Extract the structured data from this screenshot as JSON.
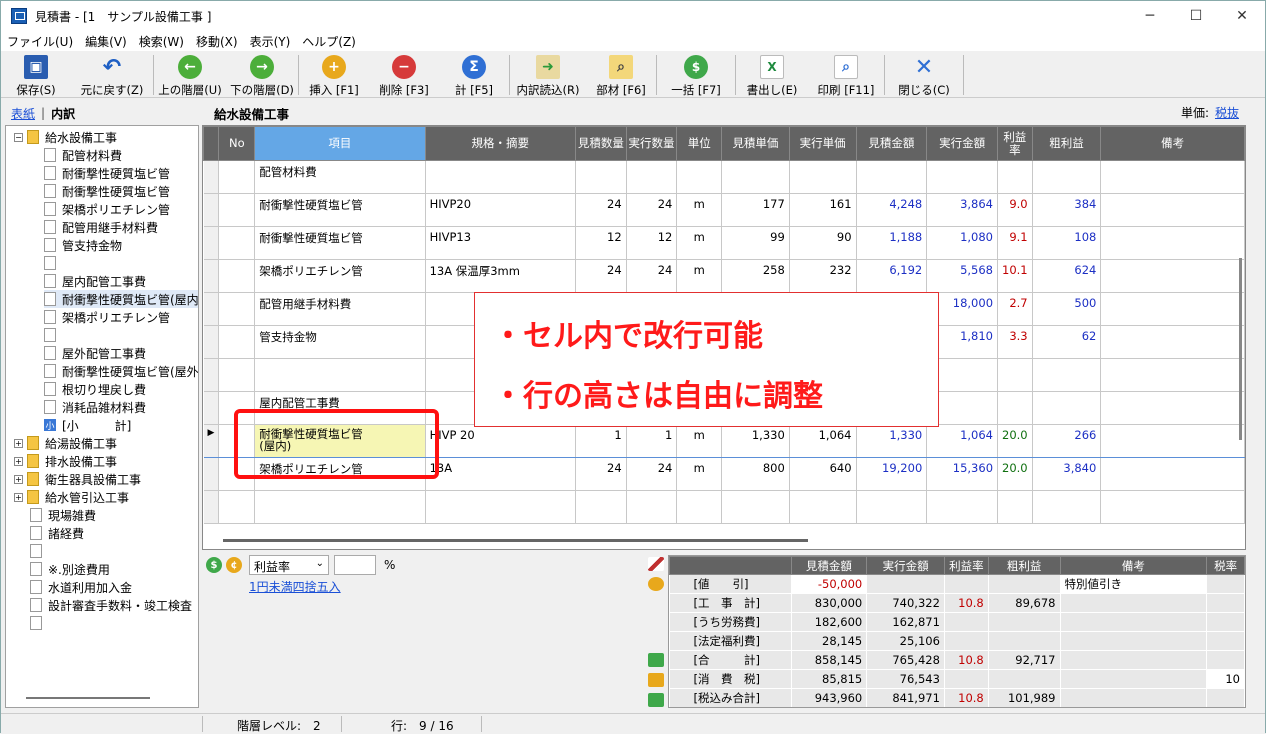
{
  "window": {
    "title": "見積書 - [1　サンプル設備工事 ]",
    "controls": [
      "─",
      "☐",
      "✕"
    ]
  },
  "menu": [
    {
      "label": "ファイル(U)",
      "name": "menu-file"
    },
    {
      "label": "編集(V)",
      "name": "menu-edit"
    },
    {
      "label": "検索(W)",
      "name": "menu-search"
    },
    {
      "label": "移動(X)",
      "name": "menu-move"
    },
    {
      "label": "表示(Y)",
      "name": "menu-view"
    },
    {
      "label": "ヘルプ(Z)",
      "name": "menu-help"
    }
  ],
  "toolbar": {
    "save": "保存(S)",
    "undo": "元に戻す(Z)",
    "up": "上の階層(U)",
    "down": "下の階層(D)",
    "insert": "挿入 [F1]",
    "delete": "削除 [F3]",
    "total": "計 [F5]",
    "import": "内訳読込(R)",
    "materials": "部材 [F6]",
    "bulk": "一括 [F7]",
    "export": "書出し(E)",
    "print": "印刷 [F11]",
    "close": "閉じる(C)"
  },
  "left_tabs": {
    "cover": "表紙",
    "detail": "内訳"
  },
  "tree": [
    "給水設備工事",
    "配管材料費",
    "耐衝撃性硬質塩ビ管",
    "耐衝撃性硬質塩ビ管",
    "架橋ポリエチレン管",
    "配管用継手材料費",
    "管支持金物",
    "",
    "屋内配管工事費",
    "耐衝撃性硬質塩ビ管(屋内",
    "架橋ポリエチレン管",
    "",
    "屋外配管工事費",
    "耐衝撃性硬質塩ビ管(屋外",
    "根切り埋戻し費",
    "消耗品雑材料費",
    "[小　　　計]",
    "給湯設備工事",
    "排水設備工事",
    "衛生器具設備工事",
    "給水管引込工事",
    "現場雑費",
    "諸経費",
    "",
    "※.別途費用",
    "水道利用加入金",
    "設計審査手数料・竣工検査"
  ],
  "tree_small_badge": "小",
  "header": {
    "section_title": "給水設備工事",
    "unit_label": "単価:",
    "unit_value": "税抜"
  },
  "grid": {
    "columns": [
      "No",
      "項目",
      "規格・摘要",
      "見積数量",
      "実行数量",
      "単位",
      "見積単価",
      "実行単価",
      "見積金額",
      "実行金額",
      "利益率",
      "粗利益",
      "備考"
    ],
    "rows": [
      {
        "no": "",
        "item": "配管材料費",
        "spec": "",
        "qty": "",
        "exec_qty": "",
        "unit": "",
        "unit_price": "",
        "exec_unit_price": "",
        "amount": "",
        "exec_amount": "",
        "margin": "",
        "profit": "",
        "note": ""
      },
      {
        "no": "",
        "item": "耐衝撃性硬質塩ビ管",
        "spec": "HIVP20",
        "qty": "24",
        "exec_qty": "24",
        "unit": "m",
        "unit_price": "177",
        "exec_unit_price": "161",
        "amount": "4,248",
        "exec_amount": "3,864",
        "margin": "9.0",
        "profit": "384",
        "note": ""
      },
      {
        "no": "",
        "item": "耐衝撃性硬質塩ビ管",
        "spec": "HIVP13",
        "qty": "12",
        "exec_qty": "12",
        "unit": "m",
        "unit_price": "99",
        "exec_unit_price": "90",
        "amount": "1,188",
        "exec_amount": "1,080",
        "margin": "9.1",
        "profit": "108",
        "note": ""
      },
      {
        "no": "",
        "item": "架橋ポリエチレン管",
        "spec": "13A 保温厚3mm",
        "qty": "24",
        "exec_qty": "24",
        "unit": "m",
        "unit_price": "258",
        "exec_unit_price": "232",
        "amount": "6,192",
        "exec_amount": "5,568",
        "margin": "10.1",
        "profit": "624",
        "note": ""
      },
      {
        "no": "",
        "item": "配管用継手材料費",
        "spec": "",
        "qty": "",
        "exec_qty": "",
        "unit": "",
        "unit_price": "",
        "exec_unit_price": "",
        "amount": "",
        "exec_amount": "18,000",
        "margin": "2.7",
        "profit": "500",
        "note": ""
      },
      {
        "no": "",
        "item": "管支持金物",
        "spec": "",
        "qty": "",
        "exec_qty": "",
        "unit": "",
        "unit_price": "",
        "exec_unit_price": "",
        "amount": "",
        "exec_amount": "1,810",
        "margin": "3.3",
        "profit": "62",
        "note": ""
      },
      {
        "no": "",
        "item": "",
        "spec": "",
        "qty": "",
        "exec_qty": "",
        "unit": "",
        "unit_price": "",
        "exec_unit_price": "",
        "amount": "",
        "exec_amount": "",
        "margin": "",
        "profit": "",
        "note": ""
      },
      {
        "no": "",
        "item": "屋内配管工事費",
        "spec": "",
        "qty": "",
        "exec_qty": "",
        "unit": "",
        "unit_price": "",
        "exec_unit_price": "",
        "amount": "",
        "exec_amount": "",
        "margin": "",
        "profit": "",
        "note": ""
      },
      {
        "no": "",
        "item": "耐衝撃性硬質塩ビ管",
        "item2": "(屋内)",
        "spec": "HIVP 20",
        "qty": "1",
        "exec_qty": "1",
        "unit": "m",
        "unit_price": "1,330",
        "exec_unit_price": "1,064",
        "amount": "1,330",
        "exec_amount": "1,064",
        "margin": "20.0",
        "profit": "266",
        "note": ""
      },
      {
        "no": "",
        "item": "架橋ポリエチレン管",
        "spec": "13A",
        "qty": "24",
        "exec_qty": "24",
        "unit": "m",
        "unit_price": "800",
        "exec_unit_price": "640",
        "amount": "19,200",
        "exec_amount": "15,360",
        "margin": "20.0",
        "profit": "3,840",
        "note": ""
      },
      {
        "no": "",
        "item": "",
        "spec": "",
        "qty": "",
        "exec_qty": "",
        "unit": "",
        "unit_price": "",
        "exec_unit_price": "",
        "amount": "",
        "exec_amount": "",
        "margin": "",
        "profit": "",
        "note": ""
      }
    ]
  },
  "callout": {
    "line1": "・セル内で改行可能",
    "line2": "・行の高さは自由に調整"
  },
  "bottom": {
    "select_value": "利益率",
    "pct_label": "%",
    "round_link": "1円未満四捨五入"
  },
  "summary": {
    "columns": [
      "",
      "見積金額",
      "実行金額",
      "利益率",
      "粗利益",
      "備考",
      "税率"
    ],
    "rows": [
      {
        "label": "[値　　引]",
        "amount": "-50,000",
        "exec": "",
        "margin": "",
        "profit": "",
        "note": "特別値引き",
        "tax": ""
      },
      {
        "label": "[工　事　計]",
        "amount": "830,000",
        "exec": "740,322",
        "margin": "10.8",
        "profit": "89,678",
        "note": "",
        "tax": ""
      },
      {
        "label": "[うち労務費]",
        "amount": "182,600",
        "exec": "162,871",
        "margin": "",
        "profit": "",
        "note": "",
        "tax": ""
      },
      {
        "label": "[法定福利費]",
        "amount": "28,145",
        "exec": "25,106",
        "margin": "",
        "profit": "",
        "note": "",
        "tax": ""
      },
      {
        "label": "[合　　　計]",
        "amount": "858,145",
        "exec": "765,428",
        "margin": "10.8",
        "profit": "92,717",
        "note": "",
        "tax": ""
      },
      {
        "label": "[消　費　税]",
        "amount": "85,815",
        "exec": "76,543",
        "margin": "",
        "profit": "",
        "note": "",
        "tax": "10"
      },
      {
        "label": "[税込み合計]",
        "amount": "943,960",
        "exec": "841,971",
        "margin": "10.8",
        "profit": "101,989",
        "note": "",
        "tax": ""
      }
    ]
  },
  "status": {
    "level": "階層レベル:　2",
    "row": "行:　9 / 16"
  }
}
